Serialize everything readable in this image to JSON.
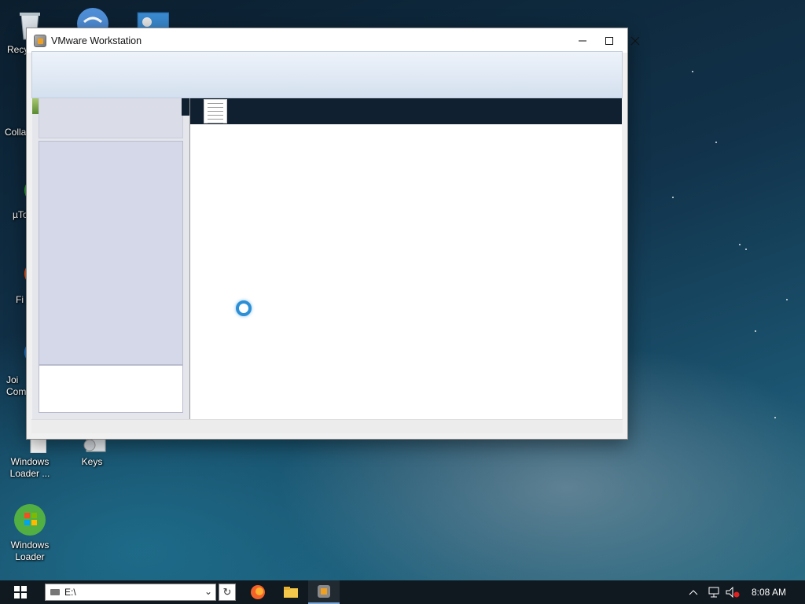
{
  "desktop": {
    "icons": [
      {
        "label": "Recy",
        "icon": "recycle-bin-icon"
      },
      {
        "label": "Colla",
        "icon": "folder-icon"
      },
      {
        "label": "µTo",
        "icon": "utorrent-icon"
      },
      {
        "label": "Fi",
        "icon": "firefox-icon"
      },
      {
        "label": "Joi\nCom",
        "icon": "globe-icon"
      },
      {
        "label": "Windows\nLoader ...",
        "icon": "document-icon"
      },
      {
        "label": "Keys",
        "icon": "gear-icon"
      },
      {
        "label": "Windows\nLoader",
        "icon": "windows-loader-icon"
      }
    ]
  },
  "window": {
    "title": "VMware Workstation",
    "controls": {
      "minimize": "—",
      "maximize": "☐",
      "close": "✕"
    }
  },
  "taskbar": {
    "address_value": "E:\\",
    "clock": "8:08 AM",
    "apps": [
      "firefox-icon",
      "file-explorer-icon",
      "vmware-icon"
    ]
  },
  "colors": {
    "accent": "#2c8fd6",
    "content_header": "#112030",
    "taskbar": "#101820"
  }
}
